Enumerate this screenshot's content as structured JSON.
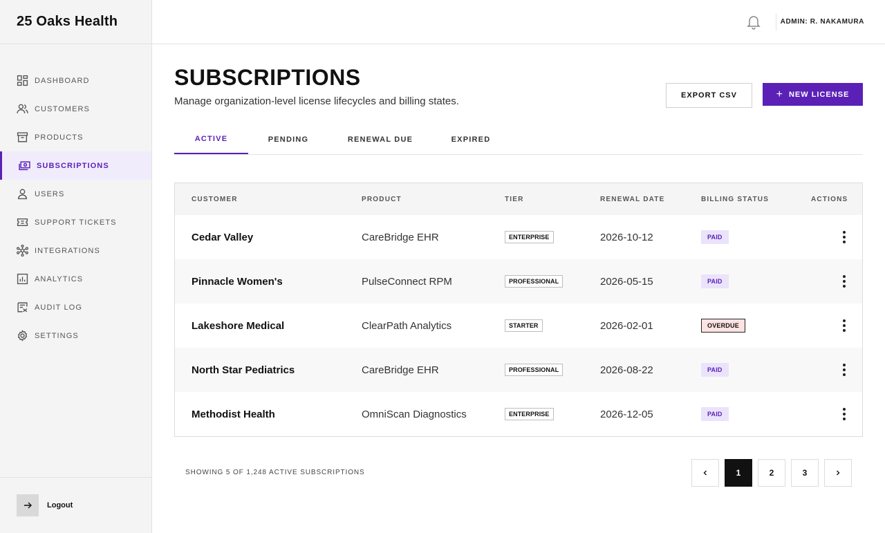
{
  "brand": {
    "name": "25 Oaks Health"
  },
  "sidebar": {
    "items": [
      {
        "label": "DASHBOARD",
        "icon": "dashboard-icon"
      },
      {
        "label": "CUSTOMERS",
        "icon": "customers-icon"
      },
      {
        "label": "PRODUCTS",
        "icon": "products-icon"
      },
      {
        "label": "SUBSCRIPTIONS",
        "icon": "subscriptions-icon",
        "active": true
      },
      {
        "label": "USERS",
        "icon": "user-icon"
      },
      {
        "label": "SUPPORT TICKETS",
        "icon": "ticket-icon"
      },
      {
        "label": "INTEGRATIONS",
        "icon": "integrations-icon"
      },
      {
        "label": "ANALYTICS",
        "icon": "analytics-icon"
      },
      {
        "label": "AUDIT LOG",
        "icon": "audit-log-icon"
      },
      {
        "label": "SETTINGS",
        "icon": "gear-icon"
      }
    ],
    "logout_label": "Logout"
  },
  "topbar": {
    "admin_label": "ADMIN: R. NAKAMURA"
  },
  "page": {
    "title": "SUBSCRIPTIONS",
    "subtitle": "Manage organization-level license lifecycles and billing states.",
    "export_label": "EXPORT CSV",
    "new_label": "NEW LICENSE"
  },
  "tabs": [
    {
      "label": "ACTIVE",
      "active": true
    },
    {
      "label": "PENDING"
    },
    {
      "label": "RENEWAL DUE"
    },
    {
      "label": "EXPIRED"
    }
  ],
  "table": {
    "headers": {
      "customer": "CUSTOMER",
      "product": "PRODUCT",
      "tier": "TIER",
      "renewal": "RENEWAL DATE",
      "billing": "BILLING STATUS",
      "actions": "ACTIONS"
    },
    "rows": [
      {
        "customer": "Cedar Valley",
        "product": "CareBridge EHR",
        "tier": "ENTERPRISE",
        "renewal": "2026-10-12",
        "status": "PAID"
      },
      {
        "customer": "Pinnacle Women's",
        "product": "PulseConnect RPM",
        "tier": "PROFESSIONAL",
        "renewal": "2026-05-15",
        "status": "PAID"
      },
      {
        "customer": "Lakeshore Medical",
        "product": "ClearPath Analytics",
        "tier": "STARTER",
        "renewal": "2026-02-01",
        "status": "OVERDUE"
      },
      {
        "customer": "North Star Pediatrics",
        "product": "CareBridge EHR",
        "tier": "PROFESSIONAL",
        "renewal": "2026-08-22",
        "status": "PAID"
      },
      {
        "customer": "Methodist Health",
        "product": "OmniScan Diagnostics",
        "tier": "ENTERPRISE",
        "renewal": "2026-12-05",
        "status": "PAID"
      }
    ]
  },
  "footer": {
    "showing": "SHOWING 5 OF 1,248 ACTIVE SUBSCRIPTIONS",
    "pages": [
      "1",
      "2",
      "3"
    ],
    "current_page": "1"
  },
  "colors": {
    "accent": "#5b21b6",
    "paid_bg": "#ebe3fb",
    "overdue_bg": "#fde2e2"
  }
}
